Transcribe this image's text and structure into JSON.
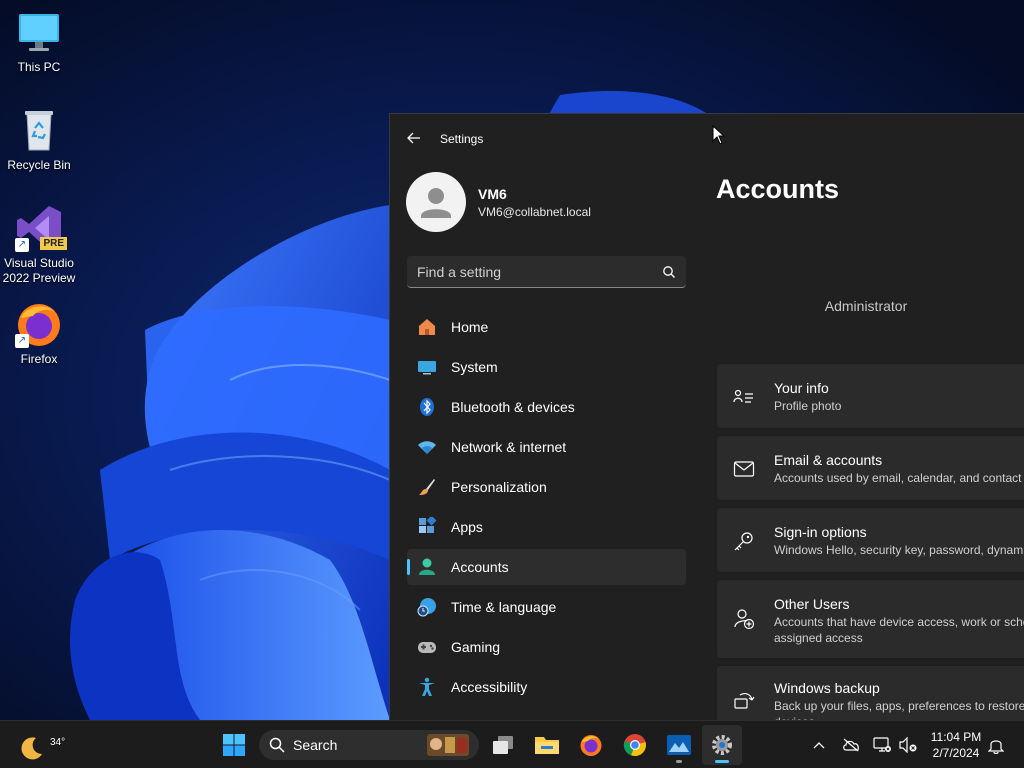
{
  "desktop": {
    "icons": [
      {
        "label": "This PC",
        "icon": "monitor-icon"
      },
      {
        "label": "Recycle Bin",
        "icon": "recycle-bin-icon"
      },
      {
        "label": "Visual Studio 2022 Preview",
        "icon": "visual-studio-icon",
        "badge": "PRE"
      },
      {
        "label": "Firefox",
        "icon": "firefox-icon"
      }
    ]
  },
  "settings": {
    "window_title": "Settings",
    "user": {
      "name": "VM6",
      "email": "VM6@collabnet.local"
    },
    "search": {
      "placeholder": "Find a setting"
    },
    "nav": [
      {
        "label": "Home",
        "icon": "home-icon"
      },
      {
        "label": "System",
        "icon": "system-icon"
      },
      {
        "label": "Bluetooth & devices",
        "icon": "bluetooth-icon"
      },
      {
        "label": "Network & internet",
        "icon": "wifi-icon"
      },
      {
        "label": "Personalization",
        "icon": "brush-icon"
      },
      {
        "label": "Apps",
        "icon": "apps-icon"
      },
      {
        "label": "Accounts",
        "icon": "accounts-icon",
        "selected": true
      },
      {
        "label": "Time & language",
        "icon": "globe-clock-icon"
      },
      {
        "label": "Gaming",
        "icon": "gamepad-icon"
      },
      {
        "label": "Accessibility",
        "icon": "accessibility-icon"
      }
    ],
    "page_title": "Accounts",
    "role": "Administrator",
    "cards": [
      {
        "title": "Your info",
        "subtitle": "Profile photo",
        "icon": "your-info-icon"
      },
      {
        "title": "Email & accounts",
        "subtitle": "Accounts used by email, calendar, and contact",
        "icon": "mail-icon"
      },
      {
        "title": "Sign-in options",
        "subtitle": "Windows Hello, security key, password, dynam",
        "icon": "key-icon"
      },
      {
        "title": "Other Users",
        "subtitle": "Accounts that have device access, work or scho assigned access",
        "icon": "add-user-icon"
      },
      {
        "title": "Windows backup",
        "subtitle": "Back up your files, apps, preferences to restore devices",
        "icon": "backup-icon"
      }
    ]
  },
  "taskbar": {
    "weather_temp": "34°",
    "search_label": "Search",
    "clock": {
      "time": "11:04 PM",
      "date": "2/7/2024"
    },
    "accent": "#4cc2ff"
  }
}
